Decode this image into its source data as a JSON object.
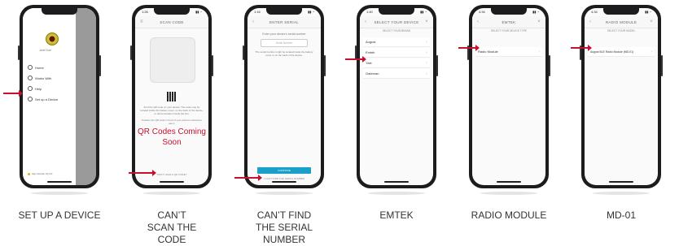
{
  "steps": [
    {
      "caption": "SET UP A DEVICE"
    },
    {
      "caption": "CAN’T SCAN THE CODE"
    },
    {
      "caption": "CAN’T FIND THE SERIAL NUMBER"
    },
    {
      "caption": "EMTEK"
    },
    {
      "caption": "RADIO MODULE"
    },
    {
      "caption": "MD-01"
    }
  ],
  "screen1": {
    "time": "",
    "user_name": "Jane Doe",
    "menu": [
      "Home",
      "Works With",
      "Help",
      "Set up a Device"
    ],
    "footer": "App Version 10.0.0"
  },
  "screen2": {
    "time": "1:26",
    "title": "SCAN CODE",
    "instructions": "Find the QR code on your device. The code may be located inside the battery cover, on the back of the device, or documentation inside the box.",
    "instructions2": "Position the QR code in front of your phone's camera to use it.",
    "qr_soon": "QR Codes Coming Soon",
    "no_code_link": "DON'T HAVE A QR CODE?"
  },
  "screen3": {
    "time": "1:16",
    "title": "ENTER SERIAL",
    "prompt": "Enter your device's serial number",
    "placeholder": "Serial Number",
    "note": "The serial number might be located inside the battery cover or on the back of the device.",
    "continue": "CONTINUE",
    "cant_find": "I CAN'T FIND THE SERIAL NUMBER"
  },
  "screen4": {
    "time": "1:40",
    "title": "SELECT YOUR DEVICE",
    "subtitle": "SELECT YOUR BRAND",
    "items": [
      "August",
      "Emtek",
      "Yale",
      "Gateman"
    ]
  },
  "screen5": {
    "time": "4:34",
    "title": "EMTEK",
    "subtitle": "SELECT YOUR DEVICE TYPE",
    "items": [
      "Radio Module"
    ]
  },
  "screen6": {
    "time": "4:34",
    "title": "RADIO MODULE",
    "subtitle": "SELECT YOUR MODEL",
    "items": [
      "August BLE Radio Module (MD-01)"
    ]
  }
}
